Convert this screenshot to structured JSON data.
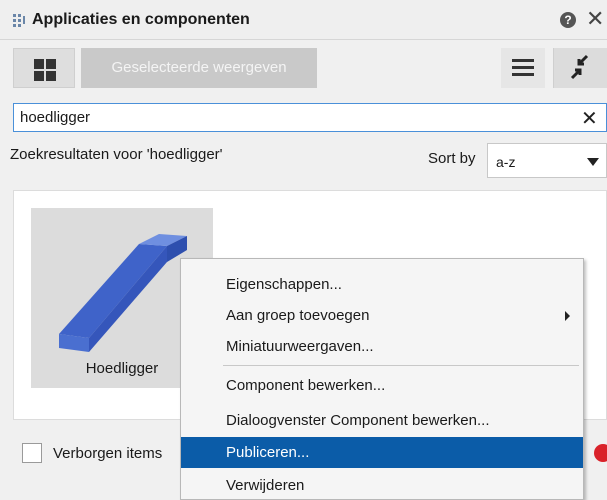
{
  "panel": {
    "title": "Applicaties en componenten",
    "help_glyph": "?",
    "close_glyph": "✕"
  },
  "toolbar": {
    "show_selected_label": "Geselecteerde weergeven"
  },
  "search": {
    "value": "hoedligger",
    "clear_glyph": "✕"
  },
  "results": {
    "label": "Zoekresultaten voor 'hoedligger'",
    "sort_by_label": "Sort by",
    "sort_value": "a-z"
  },
  "items": [
    {
      "label": "Hoedligger",
      "icon": "beam-3d-icon",
      "color": "#3f63c9"
    }
  ],
  "footer": {
    "hidden_items_label": "Verborgen items"
  },
  "context_menu": {
    "items": [
      {
        "label": "Eigenschappen..."
      },
      {
        "label": "Aan groep toevoegen",
        "submenu": true
      },
      {
        "label": "Miniatuurweergaven..."
      },
      {
        "label": "Component bewerken..."
      },
      {
        "label": "Dialoogvenster Component bewerken..."
      },
      {
        "label": "Publiceren...",
        "highlighted": true
      },
      {
        "label": "Verwijderen"
      }
    ],
    "highlight_color": "#0b5ca8"
  }
}
